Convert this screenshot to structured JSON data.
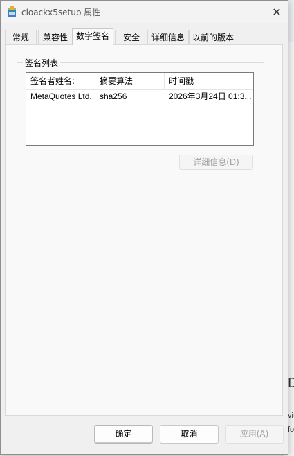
{
  "window": {
    "title": "cloackx5setup 属性",
    "close_glyph": "✕"
  },
  "tabs": [
    {
      "label": "常规"
    },
    {
      "label": "兼容性"
    },
    {
      "label": "数字签名"
    },
    {
      "label": "安全"
    },
    {
      "label": "详细信息"
    },
    {
      "label": "以前的版本"
    }
  ],
  "active_tab": "数字签名",
  "signature_list": {
    "group_label": "签名列表",
    "columns": [
      "签名者姓名:",
      "摘要算法",
      "时间戳"
    ],
    "rows": [
      {
        "signer": "MetaQuotes Ltd.",
        "digest": "sha256",
        "timestamp": "2026年3月24日 01:3..."
      }
    ],
    "details_button": "详细信息(D)"
  },
  "footer": {
    "ok": "确定",
    "cancel": "取消",
    "apply": "应用(A)"
  },
  "background_window": {
    "glyphs": [
      "D",
      "vit",
      "fo"
    ]
  }
}
